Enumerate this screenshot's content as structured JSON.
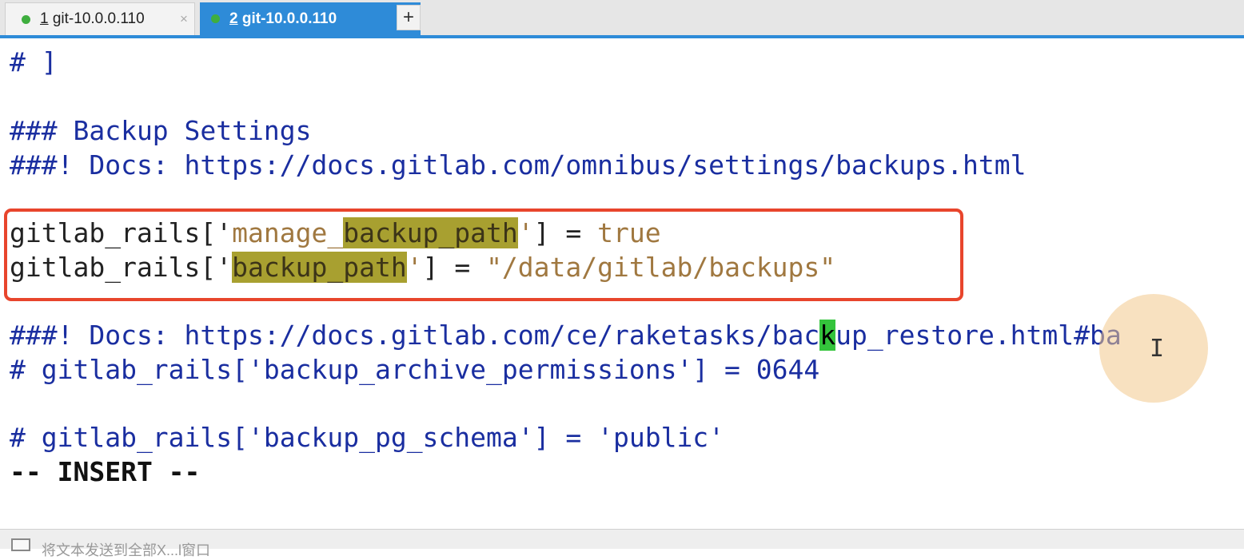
{
  "tabs": [
    {
      "number": "1",
      "label": " git-10.0.0.110",
      "close": "×"
    },
    {
      "number": "2",
      "label": " git-10.0.0.110",
      "close": "×"
    }
  ],
  "add_tab": "+",
  "editor": {
    "l1": "# ]",
    "l2": "### Backup Settings",
    "l3": "###! Docs: https://docs.gitlab.com/omnibus/settings/backups.html",
    "l4": {
      "a": "gitlab_rails['",
      "b": "manage_",
      "c": "backup_path",
      "d": "'",
      "e": "] = ",
      "f": "true"
    },
    "l5": {
      "a": "gitlab_rails['",
      "b": "backup_path",
      "c": "'",
      "d": "] = ",
      "e": "\"/data/gitlab/backups\""
    },
    "l6": {
      "a": "###! Docs: https://docs.gitlab.com/ce/raketasks/bac",
      "b": "k",
      "c": "up_restore.html#ba"
    },
    "l7": "# gitlab_rails['backup_archive_permissions'] = 0644",
    "l8": "# gitlab_rails['backup_pg_schema'] = 'public'",
    "mode": "-- INSERT --"
  },
  "status": {
    "text": "将文本发送到全部X...l窗口"
  },
  "colors": {
    "tab_active": "#2e8bd8",
    "annotation_box": "#e8452c",
    "search_highlight": "#a8a030",
    "cursor": "#34c43c"
  }
}
